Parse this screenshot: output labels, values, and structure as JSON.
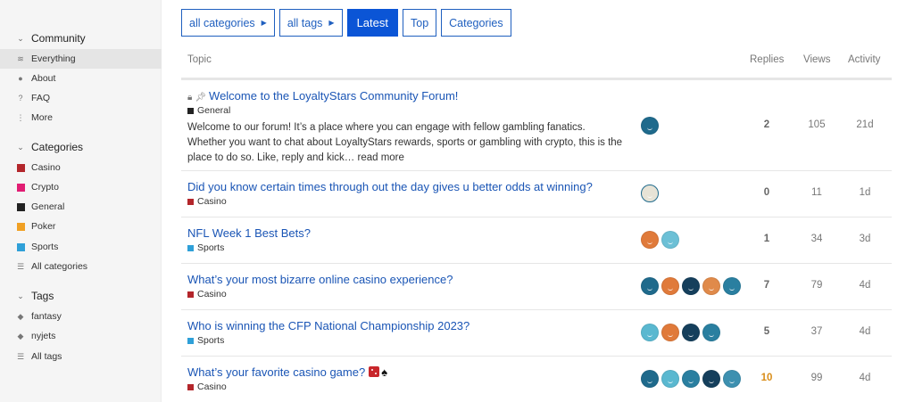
{
  "sidebar": {
    "community": {
      "heading": "Community",
      "items": [
        {
          "label": "Everything",
          "icon": "layers-icon",
          "active": true
        },
        {
          "label": "About",
          "icon": "info-icon"
        },
        {
          "label": "FAQ",
          "icon": "question-icon"
        },
        {
          "label": "More",
          "icon": "vertical-ellipsis-icon"
        }
      ]
    },
    "categories": {
      "heading": "Categories",
      "items": [
        {
          "label": "Casino",
          "color": "#b3262b"
        },
        {
          "label": "Crypto",
          "color": "#e11d73"
        },
        {
          "label": "General",
          "color": "#222222"
        },
        {
          "label": "Poker",
          "color": "#f0a024"
        },
        {
          "label": "Sports",
          "color": "#2fa0d8"
        },
        {
          "label": "All categories",
          "icon": "list-icon"
        }
      ]
    },
    "tags": {
      "heading": "Tags",
      "items": [
        {
          "label": "fantasy",
          "icon": "tag-icon"
        },
        {
          "label": "nyjets",
          "icon": "tag-icon"
        },
        {
          "label": "All tags",
          "icon": "list-icon"
        }
      ]
    }
  },
  "nav": {
    "all_categories": "all categories",
    "all_tags": "all tags",
    "latest": "Latest",
    "top": "Top",
    "categories": "Categories"
  },
  "table": {
    "headers": {
      "topic": "Topic",
      "replies": "Replies",
      "views": "Views",
      "activity": "Activity"
    },
    "rows": [
      {
        "title": "Welcome to the LoyaltyStars Community Forum!",
        "category": "General",
        "category_color": "#222222",
        "excerpt": "Welcome to our forum! It’s a place where you can engage with fellow gambling fanatics. Whether you want to chat about LoyaltyStars rewards, sports or gambling with crypto, this is the place to do so. Like, reply and kick…",
        "read_more": "read more",
        "posters": [
          "#1f6a8c"
        ],
        "replies": "2",
        "views": "105",
        "activity": "21d"
      },
      {
        "title": "Did you know certain times through out the day gives u better odds at winning?",
        "category": "Casino",
        "category_color": "#b3262b",
        "posters": [
          "#e7e3d6"
        ],
        "replies": "0",
        "views": "11",
        "activity": "1d"
      },
      {
        "title": "NFL Week 1 Best Bets?",
        "category": "Sports",
        "category_color": "#2fa0d8",
        "posters": [
          "#e07a3a",
          "#6cc0d6"
        ],
        "replies": "1",
        "views": "34",
        "activity": "3d"
      },
      {
        "title": "What’s your most bizarre online casino experience?",
        "category": "Casino",
        "category_color": "#b3262b",
        "posters": [
          "#1f6a8c",
          "#e07a3a",
          "#153f5c",
          "#e08a4a",
          "#2a7fa0"
        ],
        "replies": "7",
        "views": "79",
        "activity": "4d"
      },
      {
        "title": "Who is winning the CFP National Championship 2023?",
        "category": "Sports",
        "category_color": "#2fa0d8",
        "posters": [
          "#5ab8d0",
          "#e07a3a",
          "#153f5c",
          "#2a7fa0"
        ],
        "replies": "5",
        "views": "37",
        "activity": "4d"
      },
      {
        "title": "What’s your favorite casino game?",
        "category": "Casino",
        "category_color": "#b3262b",
        "posters": [
          "#1f6a8c",
          "#5ab8d0",
          "#2a7fa0",
          "#153f5c",
          "#3d90b0"
        ],
        "replies": "10",
        "views": "99",
        "activity": "4d"
      }
    ]
  }
}
